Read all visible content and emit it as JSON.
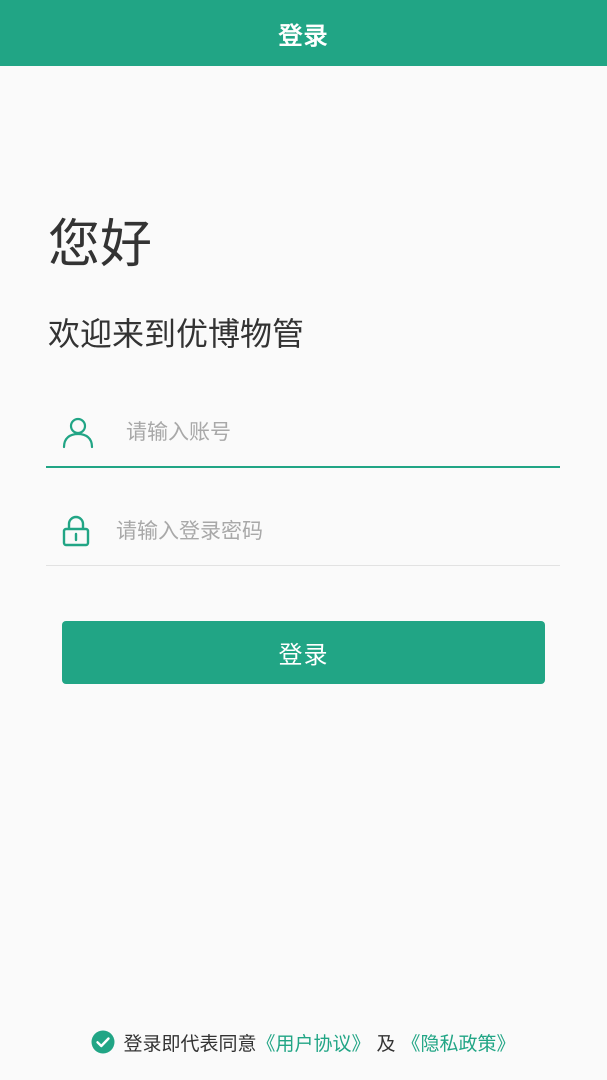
{
  "header": {
    "title": "登录"
  },
  "greeting": "您好",
  "welcome": "欢迎来到优博物管",
  "form": {
    "account_placeholder": "请输入账号",
    "password_placeholder": "请输入登录密码",
    "login_label": "登录"
  },
  "agreement": {
    "checked": true,
    "prefix": "登录即代表同意",
    "user_agreement": "《用户协议》",
    "conjunction": "及",
    "privacy_policy": "《隐私政策》"
  },
  "icons": {
    "account": "user-icon",
    "password": "lock-icon",
    "agree": "check-circle-icon"
  },
  "colors": {
    "primary": "#21a585",
    "background": "#fafafa",
    "text": "#333333",
    "placeholder": "#a8a8a8"
  }
}
